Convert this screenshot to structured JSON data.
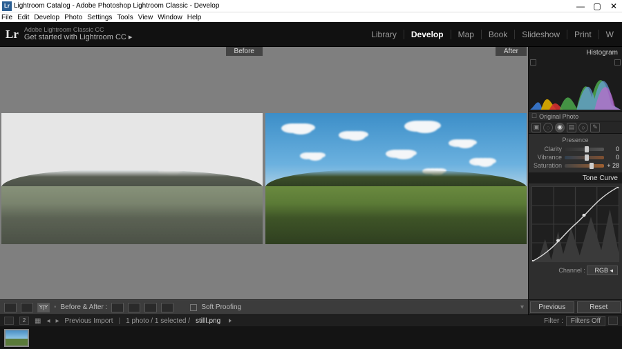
{
  "titlebar": {
    "icon": "Lr",
    "text": "Lightroom Catalog - Adobe Photoshop Lightroom Classic - Develop"
  },
  "menubar": [
    "File",
    "Edit",
    "Develop",
    "Photo",
    "Settings",
    "Tools",
    "View",
    "Window",
    "Help"
  ],
  "top": {
    "logo": "Lr",
    "brand_small": "Adobe Lightroom Classic CC",
    "brand_sub": "Get started with Lightroom CC  ▸",
    "modules": [
      "Library",
      "Develop",
      "Map",
      "Book",
      "Slideshow",
      "Print",
      "W"
    ],
    "active_module": "Develop"
  },
  "canvas": {
    "before_label": "Before",
    "after_label": "After"
  },
  "toolbar2": {
    "before_after_label": "Before & After :",
    "soft_proof_label": "Soft Proofing"
  },
  "right": {
    "histogram_label": "Histogram",
    "original_photo": "Original Photo",
    "presence_title": "Presence",
    "sliders": {
      "clarity": {
        "label": "Clarity",
        "value": "0",
        "pos": 50
      },
      "vibrance": {
        "label": "Vibrance",
        "value": "0",
        "pos": 50
      },
      "saturation": {
        "label": "Saturation",
        "value": "+ 28",
        "pos": 64
      }
    },
    "tone_curve_label": "Tone Curve",
    "channel_label": "Channel :",
    "channel_value": "RGB",
    "previous": "Previous",
    "reset": "Reset"
  },
  "filmstrip": {
    "screen": "2",
    "source": "Previous Import",
    "count": "1 photo / 1 selected /",
    "filename": "stilll.png",
    "filter_label": "Filter :",
    "filter_value": "Filters Off"
  }
}
